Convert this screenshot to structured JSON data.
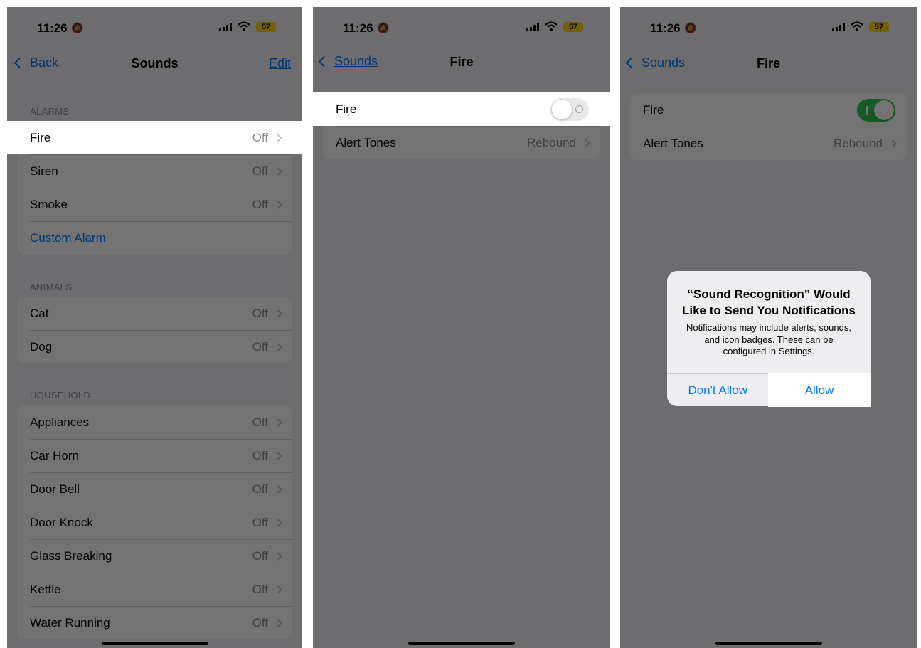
{
  "status_bar": {
    "time": "11:26",
    "battery": "57"
  },
  "panel1": {
    "nav": {
      "back_label": "Back",
      "title": "Sounds",
      "edit_label": "Edit"
    },
    "sections": [
      {
        "header": "ALARMS",
        "items": [
          {
            "label": "Fire",
            "value": "Off"
          },
          {
            "label": "Siren",
            "value": "Off"
          },
          {
            "label": "Smoke",
            "value": "Off"
          },
          {
            "label": "Custom Alarm",
            "value": ""
          }
        ]
      },
      {
        "header": "ANIMALS",
        "items": [
          {
            "label": "Cat",
            "value": "Off"
          },
          {
            "label": "Dog",
            "value": "Off"
          }
        ]
      },
      {
        "header": "HOUSEHOLD",
        "items": [
          {
            "label": "Appliances",
            "value": "Off"
          },
          {
            "label": "Car Horn",
            "value": "Off"
          },
          {
            "label": "Door Bell",
            "value": "Off"
          },
          {
            "label": "Door Knock",
            "value": "Off"
          },
          {
            "label": "Glass Breaking",
            "value": "Off"
          },
          {
            "label": "Kettle",
            "value": "Off"
          },
          {
            "label": "Water Running",
            "value": "Off"
          }
        ]
      }
    ]
  },
  "panel2": {
    "nav": {
      "back_label": "Sounds",
      "title": "Fire"
    },
    "toggle_label": "Fire",
    "toggle_state": "off",
    "alert_tones_label": "Alert Tones",
    "alert_tones_value": "Rebound"
  },
  "panel3": {
    "nav": {
      "back_label": "Sounds",
      "title": "Fire"
    },
    "toggle_label": "Fire",
    "toggle_state": "on",
    "alert_tones_label": "Alert Tones",
    "alert_tones_value": "Rebound",
    "alert": {
      "title": "“Sound Recognition” Would Like to Send You Notifications",
      "message": "Notifications may include alerts, sounds, and icon badges. These can be configured in Settings.",
      "deny_label": "Don't Allow",
      "allow_label": "Allow"
    }
  },
  "colors": {
    "accent": "#007aff",
    "toggle_on": "#34c759",
    "battery": "#ffd60a"
  }
}
